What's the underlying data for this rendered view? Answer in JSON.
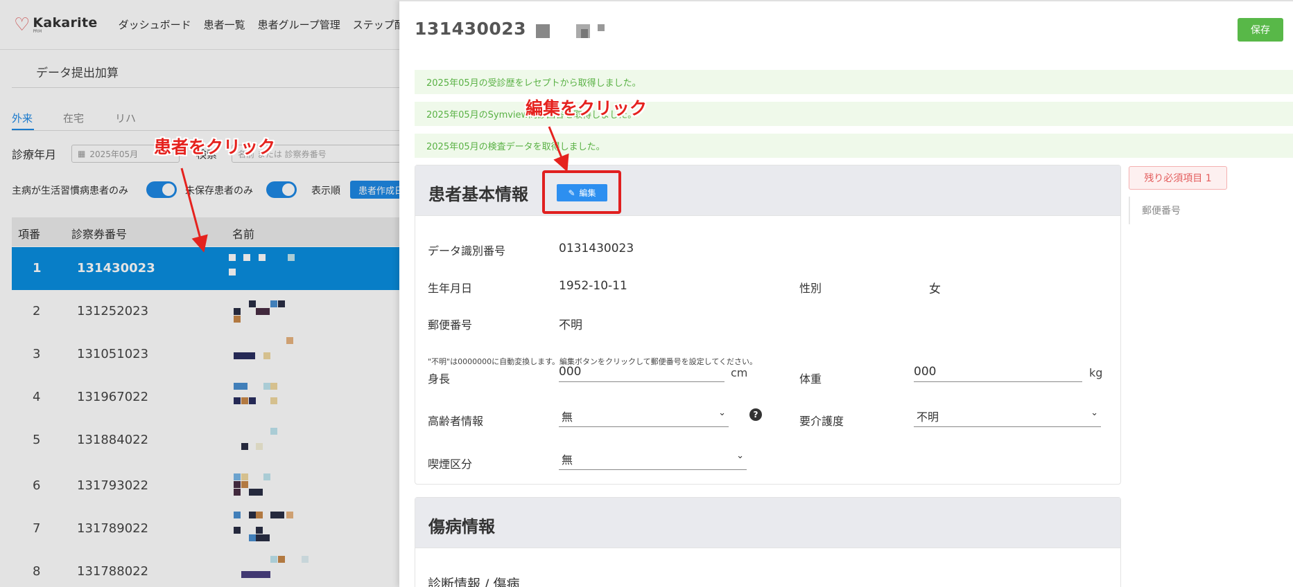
{
  "app": {
    "logo_text": "Kakarite",
    "logo_sub": "PRM",
    "nav": [
      "ダッシュボード",
      "患者一覧",
      "患者グループ管理",
      "ステップ配"
    ]
  },
  "left": {
    "page_title": "データ提出加算",
    "tabs": [
      "外来",
      "在宅",
      "リハ"
    ],
    "month_label": "診療年月",
    "month_value": "2025年05月",
    "search_label": "検索",
    "search_placeholder": "名前 または 診察券番号",
    "toggle_lifestyle": "主病が生活習慣病患者のみ",
    "toggle_unsaved": "未保存患者のみ",
    "sort_label": "表示順",
    "sort_button": "患者作成日",
    "table": {
      "headers": [
        "項番",
        "診察券番号",
        "名前"
      ],
      "rows": [
        {
          "idx": "1",
          "num": "131430023"
        },
        {
          "idx": "2",
          "num": "131252023"
        },
        {
          "idx": "3",
          "num": "131051023"
        },
        {
          "idx": "4",
          "num": "131967022"
        },
        {
          "idx": "5",
          "num": "131884022"
        },
        {
          "idx": "6",
          "num": "131793022"
        },
        {
          "idx": "7",
          "num": "131789022"
        },
        {
          "idx": "8",
          "num": "131788022"
        }
      ]
    }
  },
  "drawer": {
    "title": "131430023",
    "save_label": "保存",
    "alerts": [
      "2025年05月の受診歴をレセプトから取得しました。",
      "2025年05月のSymview問診回答を取得しました。",
      "2025年05月の検査データを取得しました。"
    ],
    "close_glyph": "×",
    "basic_info": {
      "title": "患者基本情報",
      "edit_label": "編集",
      "data_id_label": "データ識別番号",
      "data_id_value": "0131430023",
      "birth_label": "生年月日",
      "birth_value": "1952-10-11",
      "sex_label": "性別",
      "sex_value": "女",
      "postal_label": "郵便番号",
      "postal_value": "不明",
      "postal_note": "\"不明\"は0000000に自動変換します。編集ボタンをクリックして郵便番号を設定してください。",
      "height_label": "身長",
      "height_value": "000",
      "height_unit": "cm",
      "weight_label": "体重",
      "weight_value": "000",
      "weight_unit": "kg",
      "elderly_label": "高齢者情報",
      "elderly_value": "無",
      "care_label": "要介護度",
      "care_value": "不明",
      "smoking_label": "喫煙区分",
      "smoking_value": "無"
    },
    "disease": {
      "title": "傷病情報",
      "subtitle": "診断情報 / 傷病"
    },
    "required_badge": "残り必須項目 1",
    "side_link": "郵便番号"
  },
  "annotations": {
    "patient_click": "患者をクリック",
    "edit_click": "編集をクリック",
    "color": "#e5221e"
  }
}
